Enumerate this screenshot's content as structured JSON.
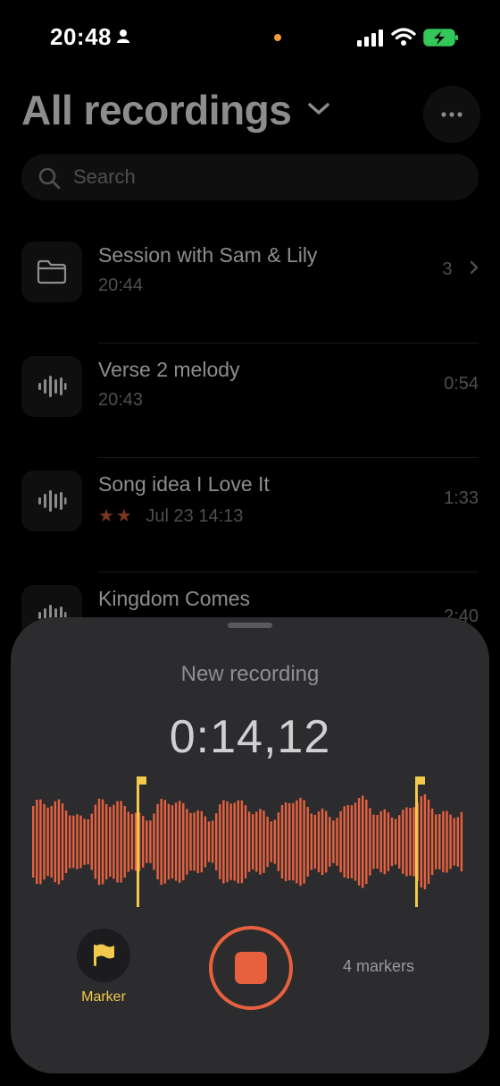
{
  "status_bar": {
    "time": "20:48"
  },
  "header": {
    "title": "All recordings"
  },
  "search": {
    "placeholder": "Search"
  },
  "recordings": [
    {
      "title": "Session with Sam & Lily",
      "subtitle": "20:44",
      "right": "3",
      "icon": "folder-icon"
    },
    {
      "title": "Verse 2 melody",
      "subtitle": "20:43",
      "right": "0:54",
      "icon": "waveform-icon"
    },
    {
      "title": "Song idea I Love It",
      "stars": "★★",
      "subtitle": "Jul 23 14:13",
      "right": "1:33",
      "icon": "waveform-icon"
    },
    {
      "title": "Kingdom Comes",
      "subtitle": "",
      "right": "2:40",
      "icon": "waveform-icon"
    }
  ],
  "recording_sheet": {
    "title": "New recording",
    "timer": "0:14,12",
    "marker_label": "Marker",
    "markers_count": "4 markers"
  },
  "colors": {
    "accent": "#e8613f",
    "marker": "#f2c94c",
    "background": "#000000",
    "sheet": "#2c2c2e"
  }
}
